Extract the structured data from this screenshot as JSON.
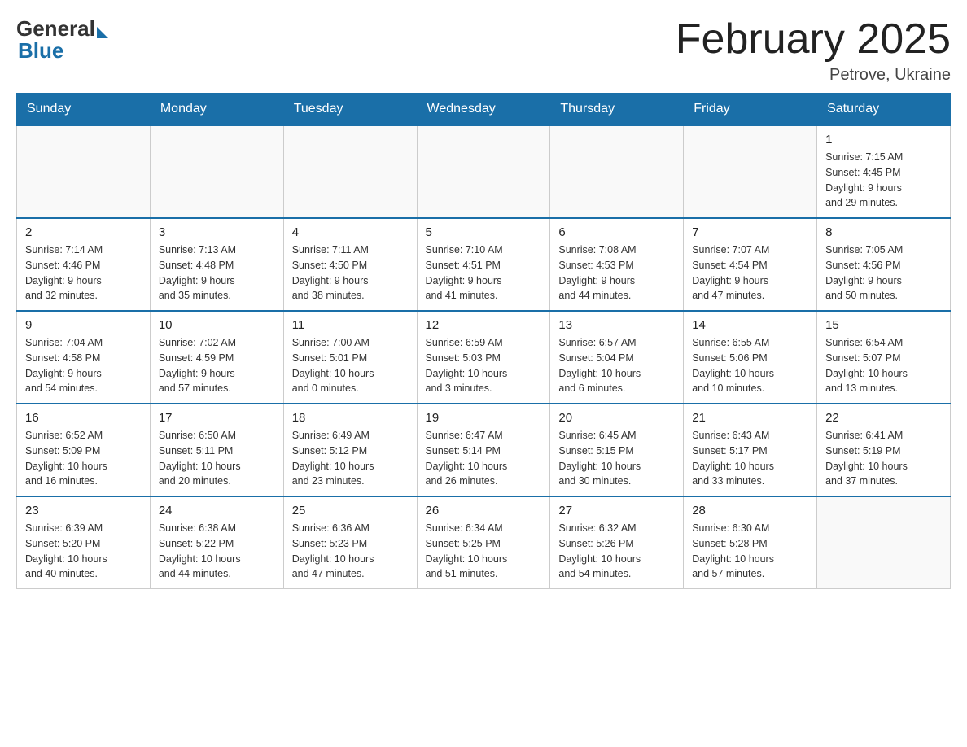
{
  "logo": {
    "general": "General",
    "blue": "Blue"
  },
  "title": "February 2025",
  "subtitle": "Petrove, Ukraine",
  "days_of_week": [
    "Sunday",
    "Monday",
    "Tuesday",
    "Wednesday",
    "Thursday",
    "Friday",
    "Saturday"
  ],
  "weeks": [
    [
      {
        "day": "",
        "info": ""
      },
      {
        "day": "",
        "info": ""
      },
      {
        "day": "",
        "info": ""
      },
      {
        "day": "",
        "info": ""
      },
      {
        "day": "",
        "info": ""
      },
      {
        "day": "",
        "info": ""
      },
      {
        "day": "1",
        "info": "Sunrise: 7:15 AM\nSunset: 4:45 PM\nDaylight: 9 hours\nand 29 minutes."
      }
    ],
    [
      {
        "day": "2",
        "info": "Sunrise: 7:14 AM\nSunset: 4:46 PM\nDaylight: 9 hours\nand 32 minutes."
      },
      {
        "day": "3",
        "info": "Sunrise: 7:13 AM\nSunset: 4:48 PM\nDaylight: 9 hours\nand 35 minutes."
      },
      {
        "day": "4",
        "info": "Sunrise: 7:11 AM\nSunset: 4:50 PM\nDaylight: 9 hours\nand 38 minutes."
      },
      {
        "day": "5",
        "info": "Sunrise: 7:10 AM\nSunset: 4:51 PM\nDaylight: 9 hours\nand 41 minutes."
      },
      {
        "day": "6",
        "info": "Sunrise: 7:08 AM\nSunset: 4:53 PM\nDaylight: 9 hours\nand 44 minutes."
      },
      {
        "day": "7",
        "info": "Sunrise: 7:07 AM\nSunset: 4:54 PM\nDaylight: 9 hours\nand 47 minutes."
      },
      {
        "day": "8",
        "info": "Sunrise: 7:05 AM\nSunset: 4:56 PM\nDaylight: 9 hours\nand 50 minutes."
      }
    ],
    [
      {
        "day": "9",
        "info": "Sunrise: 7:04 AM\nSunset: 4:58 PM\nDaylight: 9 hours\nand 54 minutes."
      },
      {
        "day": "10",
        "info": "Sunrise: 7:02 AM\nSunset: 4:59 PM\nDaylight: 9 hours\nand 57 minutes."
      },
      {
        "day": "11",
        "info": "Sunrise: 7:00 AM\nSunset: 5:01 PM\nDaylight: 10 hours\nand 0 minutes."
      },
      {
        "day": "12",
        "info": "Sunrise: 6:59 AM\nSunset: 5:03 PM\nDaylight: 10 hours\nand 3 minutes."
      },
      {
        "day": "13",
        "info": "Sunrise: 6:57 AM\nSunset: 5:04 PM\nDaylight: 10 hours\nand 6 minutes."
      },
      {
        "day": "14",
        "info": "Sunrise: 6:55 AM\nSunset: 5:06 PM\nDaylight: 10 hours\nand 10 minutes."
      },
      {
        "day": "15",
        "info": "Sunrise: 6:54 AM\nSunset: 5:07 PM\nDaylight: 10 hours\nand 13 minutes."
      }
    ],
    [
      {
        "day": "16",
        "info": "Sunrise: 6:52 AM\nSunset: 5:09 PM\nDaylight: 10 hours\nand 16 minutes."
      },
      {
        "day": "17",
        "info": "Sunrise: 6:50 AM\nSunset: 5:11 PM\nDaylight: 10 hours\nand 20 minutes."
      },
      {
        "day": "18",
        "info": "Sunrise: 6:49 AM\nSunset: 5:12 PM\nDaylight: 10 hours\nand 23 minutes."
      },
      {
        "day": "19",
        "info": "Sunrise: 6:47 AM\nSunset: 5:14 PM\nDaylight: 10 hours\nand 26 minutes."
      },
      {
        "day": "20",
        "info": "Sunrise: 6:45 AM\nSunset: 5:15 PM\nDaylight: 10 hours\nand 30 minutes."
      },
      {
        "day": "21",
        "info": "Sunrise: 6:43 AM\nSunset: 5:17 PM\nDaylight: 10 hours\nand 33 minutes."
      },
      {
        "day": "22",
        "info": "Sunrise: 6:41 AM\nSunset: 5:19 PM\nDaylight: 10 hours\nand 37 minutes."
      }
    ],
    [
      {
        "day": "23",
        "info": "Sunrise: 6:39 AM\nSunset: 5:20 PM\nDaylight: 10 hours\nand 40 minutes."
      },
      {
        "day": "24",
        "info": "Sunrise: 6:38 AM\nSunset: 5:22 PM\nDaylight: 10 hours\nand 44 minutes."
      },
      {
        "day": "25",
        "info": "Sunrise: 6:36 AM\nSunset: 5:23 PM\nDaylight: 10 hours\nand 47 minutes."
      },
      {
        "day": "26",
        "info": "Sunrise: 6:34 AM\nSunset: 5:25 PM\nDaylight: 10 hours\nand 51 minutes."
      },
      {
        "day": "27",
        "info": "Sunrise: 6:32 AM\nSunset: 5:26 PM\nDaylight: 10 hours\nand 54 minutes."
      },
      {
        "day": "28",
        "info": "Sunrise: 6:30 AM\nSunset: 5:28 PM\nDaylight: 10 hours\nand 57 minutes."
      },
      {
        "day": "",
        "info": ""
      }
    ]
  ]
}
